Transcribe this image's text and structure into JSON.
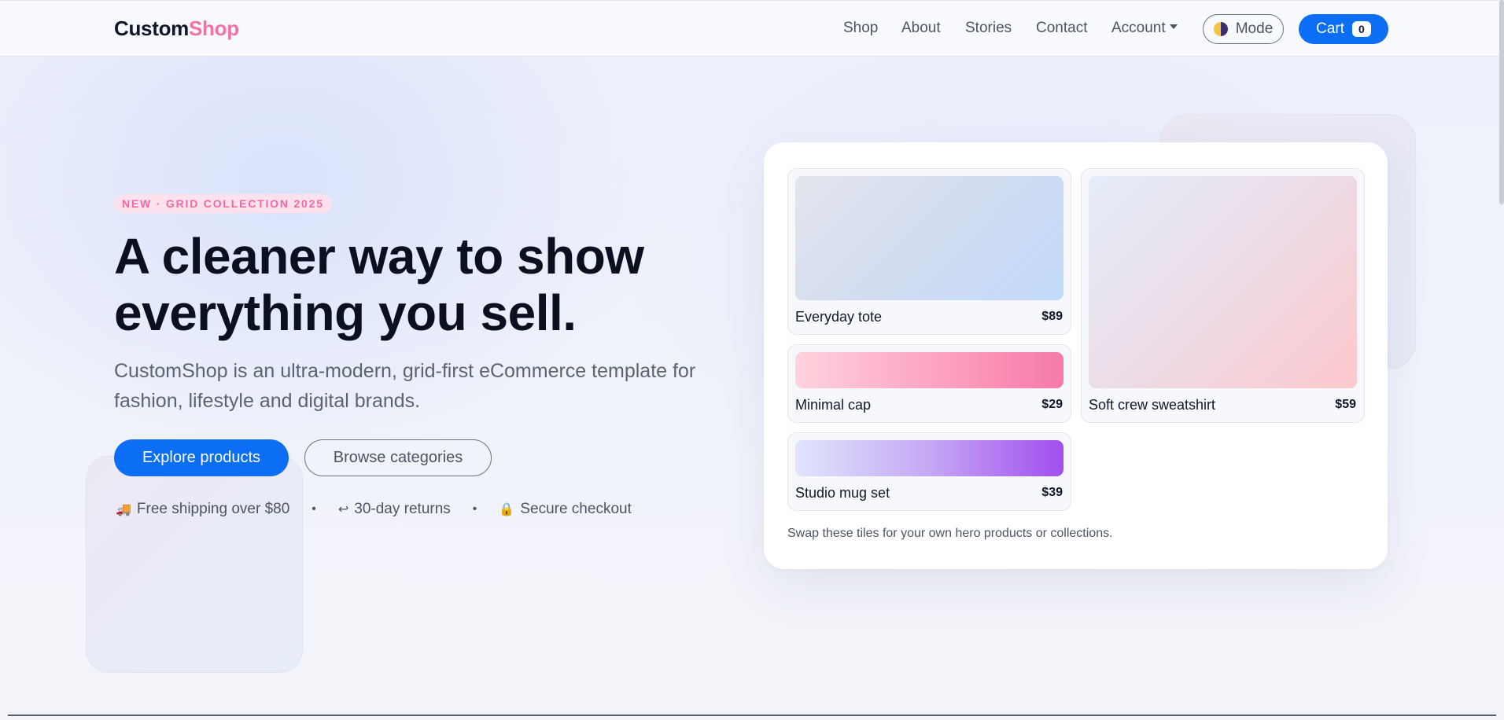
{
  "brand": {
    "part1": "Custom",
    "part2": "Shop"
  },
  "nav": {
    "links": [
      "Shop",
      "About",
      "Stories",
      "Contact"
    ],
    "account_label": "Account",
    "mode_label": "Mode",
    "cart_label": "Cart",
    "cart_count": "0"
  },
  "hero": {
    "badge": "NEW · GRID COLLECTION 2025",
    "title_line1": "A cleaner way to show",
    "title_line2": "everything you sell.",
    "subtitle_line1": "CustomShop is an ultra-modern, grid-first eCommerce template for",
    "subtitle_line2": "fashion, lifestyle and digital brands.",
    "primary_cta": "Explore products",
    "secondary_cta": "Browse categories",
    "perks": [
      {
        "icon": "🚚",
        "text": "Free shipping over $80"
      },
      {
        "icon": "↩",
        "text": "30-day returns"
      },
      {
        "icon": "🔒",
        "text": "Secure checkout"
      }
    ],
    "perk_separator": "•"
  },
  "products": [
    {
      "name": "Everyday tote",
      "price": "$89"
    },
    {
      "name": "Soft crew sweatshirt",
      "price": "$59"
    },
    {
      "name": "Minimal cap",
      "price": "$29"
    },
    {
      "name": "Studio mug set",
      "price": "$39"
    }
  ],
  "card_note": "Swap these tiles for your own hero products or collections.",
  "colors": {
    "accent": "#0b6ef5",
    "brand_pink": "#f472a6",
    "text": "#0f172a",
    "muted": "#4b5563"
  }
}
